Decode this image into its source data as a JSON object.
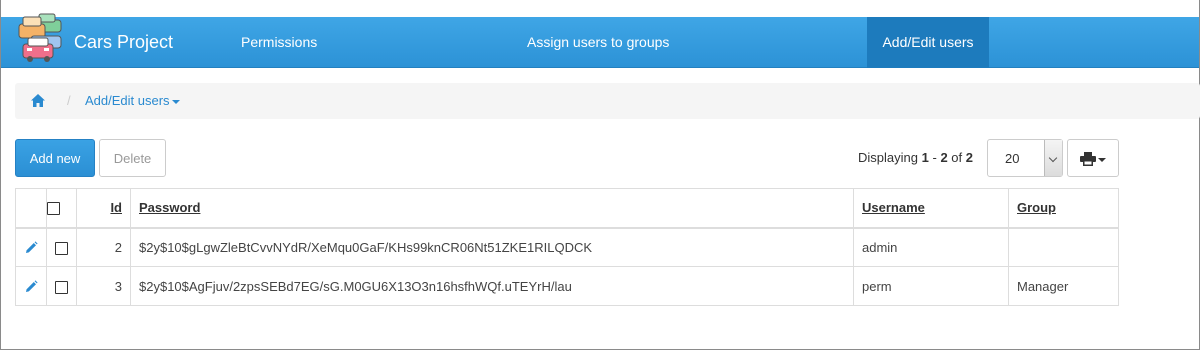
{
  "app": {
    "title": "Cars Project"
  },
  "nav": {
    "items": [
      {
        "label": "Permissions",
        "active": false
      },
      {
        "label": "Assign users to groups",
        "active": false
      },
      {
        "label": "Add/Edit users",
        "active": true
      }
    ]
  },
  "breadcrumb": {
    "home_icon": "home-icon",
    "current": "Add/Edit users"
  },
  "toolbar": {
    "add_label": "Add new",
    "delete_label": "Delete",
    "displaying_prefix": "Displaying",
    "range_start": "1",
    "range_sep": "-",
    "range_end": "2",
    "of_label": "of",
    "total": "2",
    "page_size": "20",
    "print_icon": "printer-icon"
  },
  "table": {
    "columns": [
      "Id",
      "Password",
      "Username",
      "Group"
    ],
    "rows": [
      {
        "id": "2",
        "password": "$2y$10$gLgwZleBtCvvNYdR/XeMqu0GaF/KHs99knCR06Nt51ZKE1RILQDCK",
        "username": "admin",
        "group": ""
      },
      {
        "id": "3",
        "password": "$2y$10$AgFjuv/2zpsSEBd7EG/sG.M0GU6X13O3n16hsfhWQf.uTEYrH/lau",
        "username": "perm",
        "group": "Manager"
      }
    ]
  },
  "colors": {
    "navbar": "#2c92d6",
    "nav_active": "#1d7bbd",
    "link": "#2a8ad0"
  }
}
